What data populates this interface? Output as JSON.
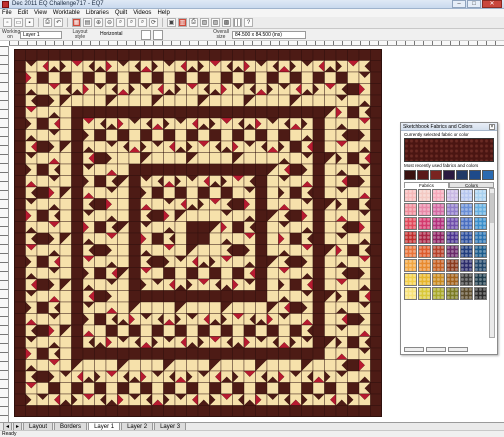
{
  "window": {
    "title": "Dec 2011 EQ Challenge717 - EQ7",
    "buttons": [
      "–",
      "□",
      "✕"
    ]
  },
  "menu": [
    "File",
    "Edit",
    "View",
    "Worktable",
    "Libraries",
    "Quilt",
    "Videos",
    "Help"
  ],
  "options": {
    "working_on_label": "Working on",
    "working_on_value": "Layer 1",
    "layout_style_label": "Layout style",
    "layout_style_value": "Horizontal",
    "overall_size_label": "Overall size",
    "overall_size_value": "84.500 x 84.500 (ins)"
  },
  "palette": {
    "title": "Sketchbook Fabrics and Colors",
    "current_label": "Currently selected fabric or color",
    "recent_label": "Most recently used fabrics and colors",
    "tabs": [
      "Fabrics",
      "Colors"
    ],
    "recent_colors": [
      "#3a1210",
      "#5a1a1a",
      "#7a2420",
      "#2a1a40",
      "#223a66",
      "#1e4a8a",
      "#2a6ab0"
    ],
    "swatch_colors": [
      "#f6b8b8",
      "#f3c9c2",
      "#f5a7b9",
      "#c8b7e3",
      "#b7c7ef",
      "#a9d1ef",
      "#ef8c9a",
      "#e889a8",
      "#d36aa3",
      "#8f7cc9",
      "#6a8fd6",
      "#67b0e0",
      "#e2495b",
      "#d33a6d",
      "#b32f7c",
      "#6f4dab",
      "#4a6ec0",
      "#3a8fcb",
      "#c02e2e",
      "#a82443",
      "#8c2060",
      "#4b3490",
      "#2c4e9c",
      "#2a72b0",
      "#e8743a",
      "#dc5a2c",
      "#b4402a",
      "#6a2a6a",
      "#1f3c7c",
      "#1b5c8c",
      "#f2a640",
      "#e88a2e",
      "#c45e22",
      "#8a3a1e",
      "#2a2a6a",
      "#20466a",
      "#f4d04a",
      "#e6b42c",
      "#c88a1e",
      "#a0601a",
      "#3a3a3a",
      "#1c3a4a",
      "#f7e27a",
      "#d8c83a",
      "#a8a82a",
      "#7a7a22",
      "#5a4a2a",
      "#2a2a2a"
    ]
  },
  "quilt_colors": {
    "dark": "#4d1b15",
    "light": "#f6e1ab",
    "red": "#b81a30",
    "seam": "#2f110d"
  },
  "bottom_tabs": [
    "Layout",
    "Borders",
    "Layer 1",
    "Layer 2",
    "Layer 3"
  ],
  "status": "Ready"
}
